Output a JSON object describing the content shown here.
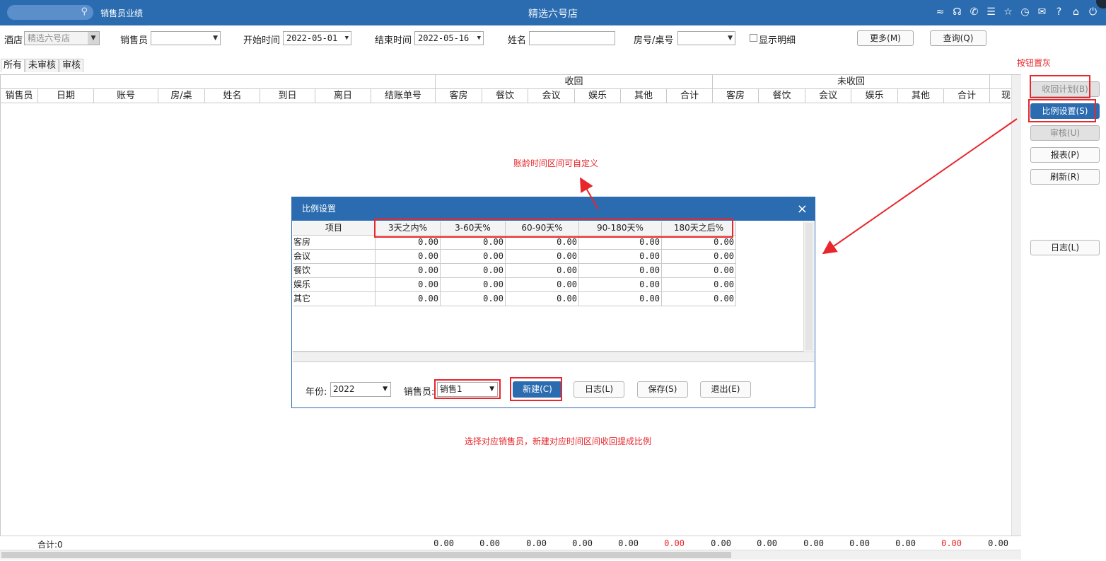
{
  "window": {
    "module": "销售员业绩",
    "store": "精选六号店",
    "icons": [
      "wifi-icon",
      "headset-icon",
      "phone-icon",
      "menu-icon",
      "star-icon",
      "clock-icon",
      "mail-icon",
      "help-icon",
      "home-icon",
      "power-icon"
    ]
  },
  "filters": {
    "hotel_label": "酒店",
    "hotel_value": "精选六号店",
    "sales_label": "销售员",
    "sales_value": "",
    "start_label": "开始时间",
    "start_value": "2022-05-01",
    "end_label": "结束时间",
    "end_value": "2022-05-16",
    "name_label": "姓名",
    "name_value": "",
    "room_label": "房号/桌号",
    "room_value": "",
    "detail_label": "显示明细",
    "more_button": "更多(M)",
    "query_button": "查询(Q)"
  },
  "tabs": [
    "所有",
    "未审核",
    "审核"
  ],
  "grid": {
    "group_received": "收回",
    "group_unreceived": "未收回",
    "columns": [
      "销售员",
      "日期",
      "账号",
      "房/桌",
      "姓名",
      "到日",
      "离日",
      "结账单号",
      "客房",
      "餐饮",
      "会议",
      "娱乐",
      "其他",
      "合计",
      "客房",
      "餐饮",
      "会议",
      "娱乐",
      "其他",
      "合计",
      "现"
    ],
    "footer_total": "合计:0",
    "footer_values": [
      "0.00",
      "0.00",
      "0.00",
      "0.00",
      "0.00",
      "0.00",
      "0.00",
      "0.00",
      "0.00",
      "0.00",
      "0.00",
      "0.00",
      "0.00"
    ],
    "accent_red": "#e8262c"
  },
  "side_buttons": {
    "plan": "收回计划(B)",
    "ratio": "比例设置(S)",
    "audit": "审核(U)",
    "report": "报表(P)",
    "refresh": "刷新(R)",
    "log": "日志(L)"
  },
  "annotations": {
    "gray_note": "按钮置灰",
    "custom_note": "账龄时间区间可自定义",
    "select_note": "选择对应销售员，新建对应时间区间收回提成比例"
  },
  "dialog": {
    "title": "比例设置",
    "columns": [
      "项目",
      "3天之内%",
      "3-60天%",
      "60-90天%",
      "90-180天%",
      "180天之后%"
    ],
    "rows": [
      {
        "name": "客房",
        "values": [
          "0.00",
          "0.00",
          "0.00",
          "0.00",
          "0.00"
        ]
      },
      {
        "name": "会议",
        "values": [
          "0.00",
          "0.00",
          "0.00",
          "0.00",
          "0.00"
        ]
      },
      {
        "name": "餐饮",
        "values": [
          "0.00",
          "0.00",
          "0.00",
          "0.00",
          "0.00"
        ]
      },
      {
        "name": "娱乐",
        "values": [
          "0.00",
          "0.00",
          "0.00",
          "0.00",
          "0.00"
        ]
      },
      {
        "name": "其它",
        "values": [
          "0.00",
          "0.00",
          "0.00",
          "0.00",
          "0.00"
        ]
      }
    ],
    "year_label": "年份:",
    "year_value": "2022",
    "sales_label": "销售员:",
    "sales_value": "销售1",
    "new_button": "新建(C)",
    "log_button": "日志(L)",
    "save_button": "保存(S)",
    "exit_button": "退出(E)"
  }
}
